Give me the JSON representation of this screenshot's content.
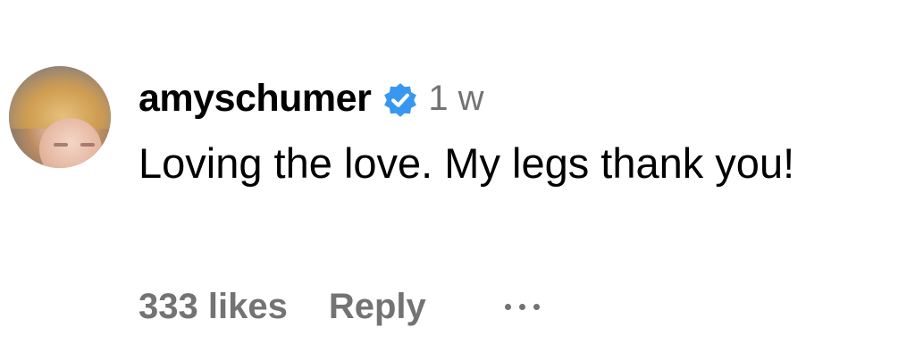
{
  "comment": {
    "username": "amyschumer",
    "verified": true,
    "verified_icon": "verified-badge-icon",
    "verified_color": "#3897f0",
    "timestamp": "1 w",
    "text": "Loving the love. My legs thank you!",
    "likes_label": "333 likes",
    "reply_label": "Reply",
    "more_icon": "more-options-icon"
  },
  "colors": {
    "primary_text": "#000000",
    "secondary_text": "#737373",
    "background": "#ffffff"
  }
}
